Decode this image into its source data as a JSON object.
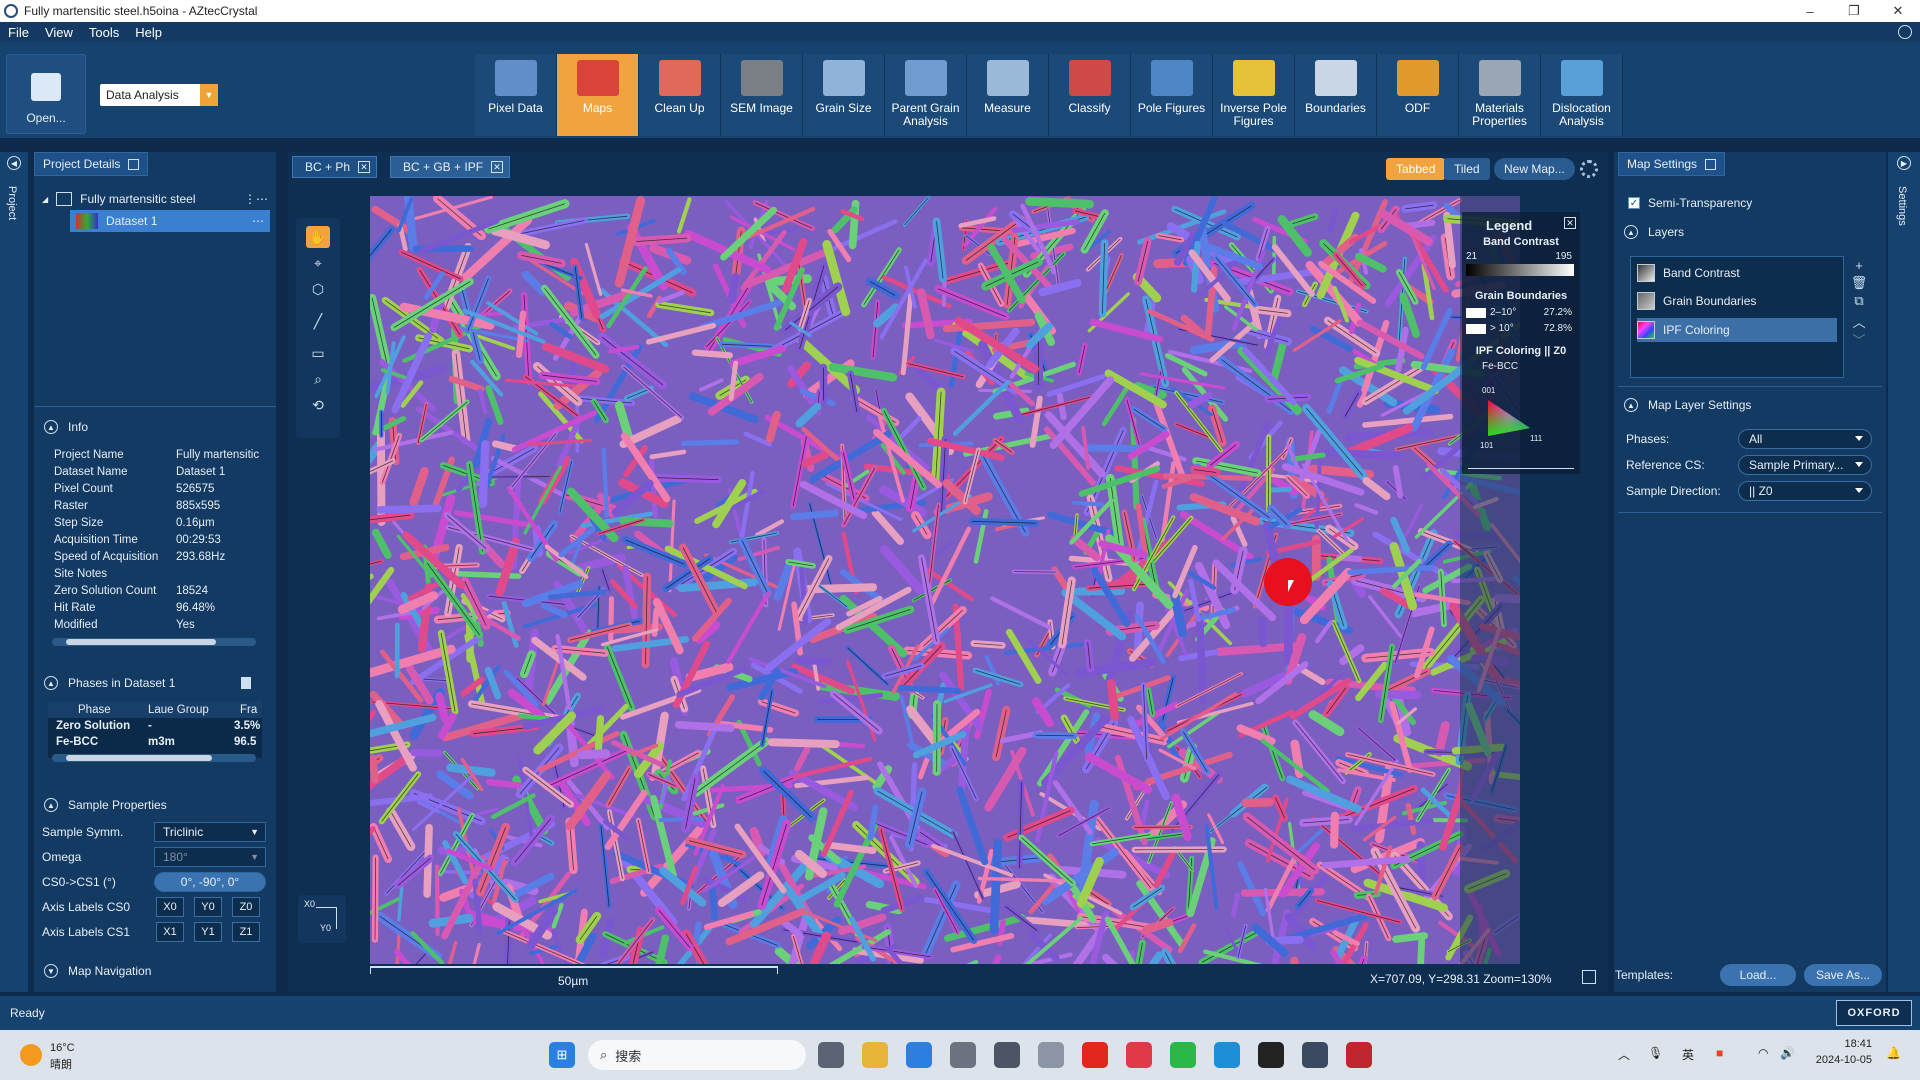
{
  "window": {
    "title": "Fully martensitic steel.h5oina - AZtecCrystal",
    "minimize": "–",
    "maximize": "❐",
    "close": "✕"
  },
  "menu": [
    "File",
    "View",
    "Tools",
    "Help"
  ],
  "ribbon": {
    "open_label": "Open...",
    "mode_selector": "Data Analysis",
    "tools": [
      {
        "label": "Pixel Data",
        "icon": "pixel-data-icon",
        "color": "#5f8ec9"
      },
      {
        "label": "Maps",
        "icon": "maps-icon",
        "color": "#d9443a",
        "active": true
      },
      {
        "label": "Clean Up",
        "icon": "clean-up-icon",
        "color": "#e06a5a"
      },
      {
        "label": "SEM Image",
        "icon": "sem-image-icon",
        "color": "#7a7f86"
      },
      {
        "label": "Grain Size",
        "icon": "grain-size-icon",
        "color": "#8fb3d9"
      },
      {
        "label": "Parent Grain\nAnalysis",
        "icon": "parent-grain-icon",
        "color": "#6f9bd0"
      },
      {
        "label": "Measure",
        "icon": "measure-icon",
        "color": "#9ab8d8"
      },
      {
        "label": "Classify",
        "icon": "classify-icon",
        "color": "#d04848"
      },
      {
        "label": "Pole Figures",
        "icon": "pole-figures-icon",
        "color": "#4f86c6"
      },
      {
        "label": "Inverse Pole\nFigures",
        "icon": "inverse-pole-icon",
        "color": "#e5c23a"
      },
      {
        "label": "Boundaries",
        "icon": "boundaries-icon",
        "color": "#c9d6e4"
      },
      {
        "label": "ODF",
        "icon": "odf-icon",
        "color": "#e39a2c"
      },
      {
        "label": "Materials\nProperties",
        "icon": "materials-icon",
        "color": "#9aa6b4"
      },
      {
        "label": "Dislocation\nAnalysis",
        "icon": "dislocation-icon",
        "color": "#5aa0d8"
      }
    ]
  },
  "left_strip": {
    "label": "Project"
  },
  "project_panel": {
    "tab": "Project Details",
    "tree": {
      "project": "Fully martensitic steel",
      "dataset": "Dataset 1"
    },
    "info_title": "Info",
    "info": [
      {
        "k": "Project Name",
        "v": "Fully martensitic"
      },
      {
        "k": "Dataset Name",
        "v": "Dataset 1"
      },
      {
        "k": "Pixel Count",
        "v": "526575"
      },
      {
        "k": "Raster",
        "v": "885x595"
      },
      {
        "k": "Step Size",
        "v": "0.16µm"
      },
      {
        "k": "Acquisition Time",
        "v": "00:29:53"
      },
      {
        "k": "Speed of Acquisition",
        "v": "293.68Hz"
      },
      {
        "k": "Site Notes",
        "v": ""
      },
      {
        "k": "Zero Solution Count",
        "v": "18524"
      },
      {
        "k": "Hit Rate",
        "v": "96.48%"
      },
      {
        "k": "Modified",
        "v": "Yes"
      }
    ],
    "phases_title": "Phases in Dataset 1",
    "phase_headers": [
      "Phase",
      "Laue Group",
      "Fra"
    ],
    "phases": [
      {
        "phase": "Zero Solution",
        "laue": "-",
        "frac": "3.5%"
      },
      {
        "phase": "Fe-BCC",
        "laue": "m3m",
        "frac": "96.5"
      }
    ],
    "sample_title": "Sample Properties",
    "sample_symm_label": "Sample Symm.",
    "sample_symm": "Triclinic",
    "omega_label": "Omega",
    "omega": "180°",
    "cs_label": "CS0->CS1 (°)",
    "cs_value": "0°, -90°, 0°",
    "axis_cs0_label": "Axis Labels CS0",
    "axis_cs0": [
      "X0",
      "Y0",
      "Z0"
    ],
    "axis_cs1_label": "Axis Labels CS1",
    "axis_cs1": [
      "X1",
      "Y1",
      "Z1"
    ],
    "nav_title": "Map Navigation"
  },
  "center": {
    "tabs": [
      {
        "label": "BC + Ph",
        "active": false
      },
      {
        "label": "BC + GB + IPF",
        "active": true
      }
    ],
    "view_tabbed": "Tabbed",
    "view_tiled": "Tiled",
    "new_map": "New Map...",
    "scale_label": "50µm",
    "coords": "X=707.09, Y=298.31 Zoom=130%",
    "axes_x": "X0",
    "axes_y": "Y0"
  },
  "legend": {
    "title": "Legend",
    "bc_title": "Band Contrast",
    "bc_min": "21",
    "bc_max": "195",
    "gb_title": "Grain Boundaries",
    "gb": [
      {
        "label": "2–10°",
        "pct": "27.2%"
      },
      {
        "label": "> 10°",
        "pct": "72.8%"
      }
    ],
    "ipf_title": "IPF Coloring || Z0",
    "ipf_phase": "Fe-BCC",
    "ipf_001": "001",
    "ipf_101": "101",
    "ipf_111": "111"
  },
  "map_settings": {
    "tab": "Map Settings",
    "semi_transparency": "Semi-Transparency",
    "layers_title": "Layers",
    "layers": [
      {
        "label": "Band Contrast",
        "selected": false
      },
      {
        "label": "Grain Boundaries",
        "selected": false
      },
      {
        "label": "IPF Coloring",
        "selected": true
      }
    ],
    "mls_title": "Map Layer Settings",
    "phases_label": "Phases:",
    "phases_value": "All",
    "refcs_label": "Reference CS:",
    "refcs_value": "Sample Primary...",
    "sampdir_label": "Sample Direction:",
    "sampdir_value": "|| Z0",
    "templates_label": "Templates:",
    "load": "Load...",
    "save_as": "Save As..."
  },
  "right_strip": {
    "label": "Settings"
  },
  "status": {
    "text": "Ready",
    "brand": "OXFORD"
  },
  "taskbar": {
    "weather_temp": "16°C",
    "weather_desc": "晴朗",
    "search_placeholder": "搜索",
    "ime": "英",
    "time": "18:41",
    "date": "2024-10-05"
  }
}
